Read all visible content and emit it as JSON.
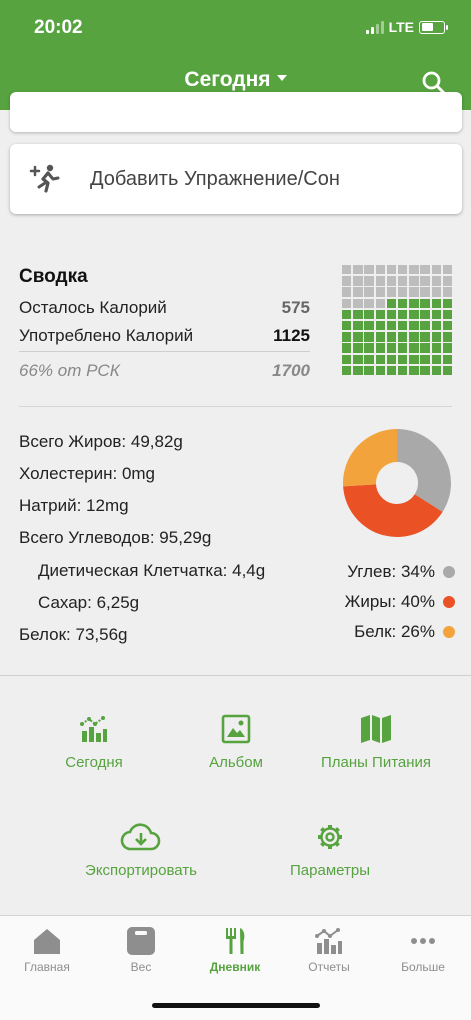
{
  "status_bar": {
    "time": "20:02",
    "network": "LTE"
  },
  "header": {
    "title": "Сегодня"
  },
  "exercise_card": {
    "label": "Добавить Упражнение/Сон"
  },
  "summary": {
    "title": "Сводка",
    "rows": [
      {
        "label": "Осталось Калорий",
        "value": "575"
      },
      {
        "label": "Употреблено Калорий",
        "value": "1125"
      },
      {
        "label": "66% от РСК",
        "value": "1700"
      }
    ],
    "calorie_grid_fraction": 0.66
  },
  "nutrients": {
    "fat": "Всего Жиров: 49,82g",
    "cholesterol": "Холестерин: 0mg",
    "sodium": "Натрий: 12mg",
    "carbs": "Всего Углеводов: 95,29g",
    "fiber": "Диетическая Клетчатка: 4,4g",
    "sugar": "Сахар: 6,25g",
    "protein": "Белок: 73,56g"
  },
  "macro_chart": {
    "slices": [
      {
        "label": "Углев: 34%",
        "percent": 34,
        "color": "#a9a9a9"
      },
      {
        "label": "Жиры: 40%",
        "percent": 40,
        "color": "#ea5125"
      },
      {
        "label": "Белк: 26%",
        "percent": 26,
        "color": "#f2a33c"
      }
    ]
  },
  "shortcuts": {
    "today": "Сегодня",
    "album": "Альбом",
    "meal_plans": "Планы Питания",
    "export": "Экспортировать",
    "settings": "Параметры"
  },
  "tabbar": {
    "home": "Главная",
    "weight": "Вес",
    "diary": "Дневник",
    "reports": "Отчеты",
    "more": "Больше"
  },
  "colors": {
    "brand": "#56a33f",
    "grid_empty": "#bdbdbd"
  }
}
